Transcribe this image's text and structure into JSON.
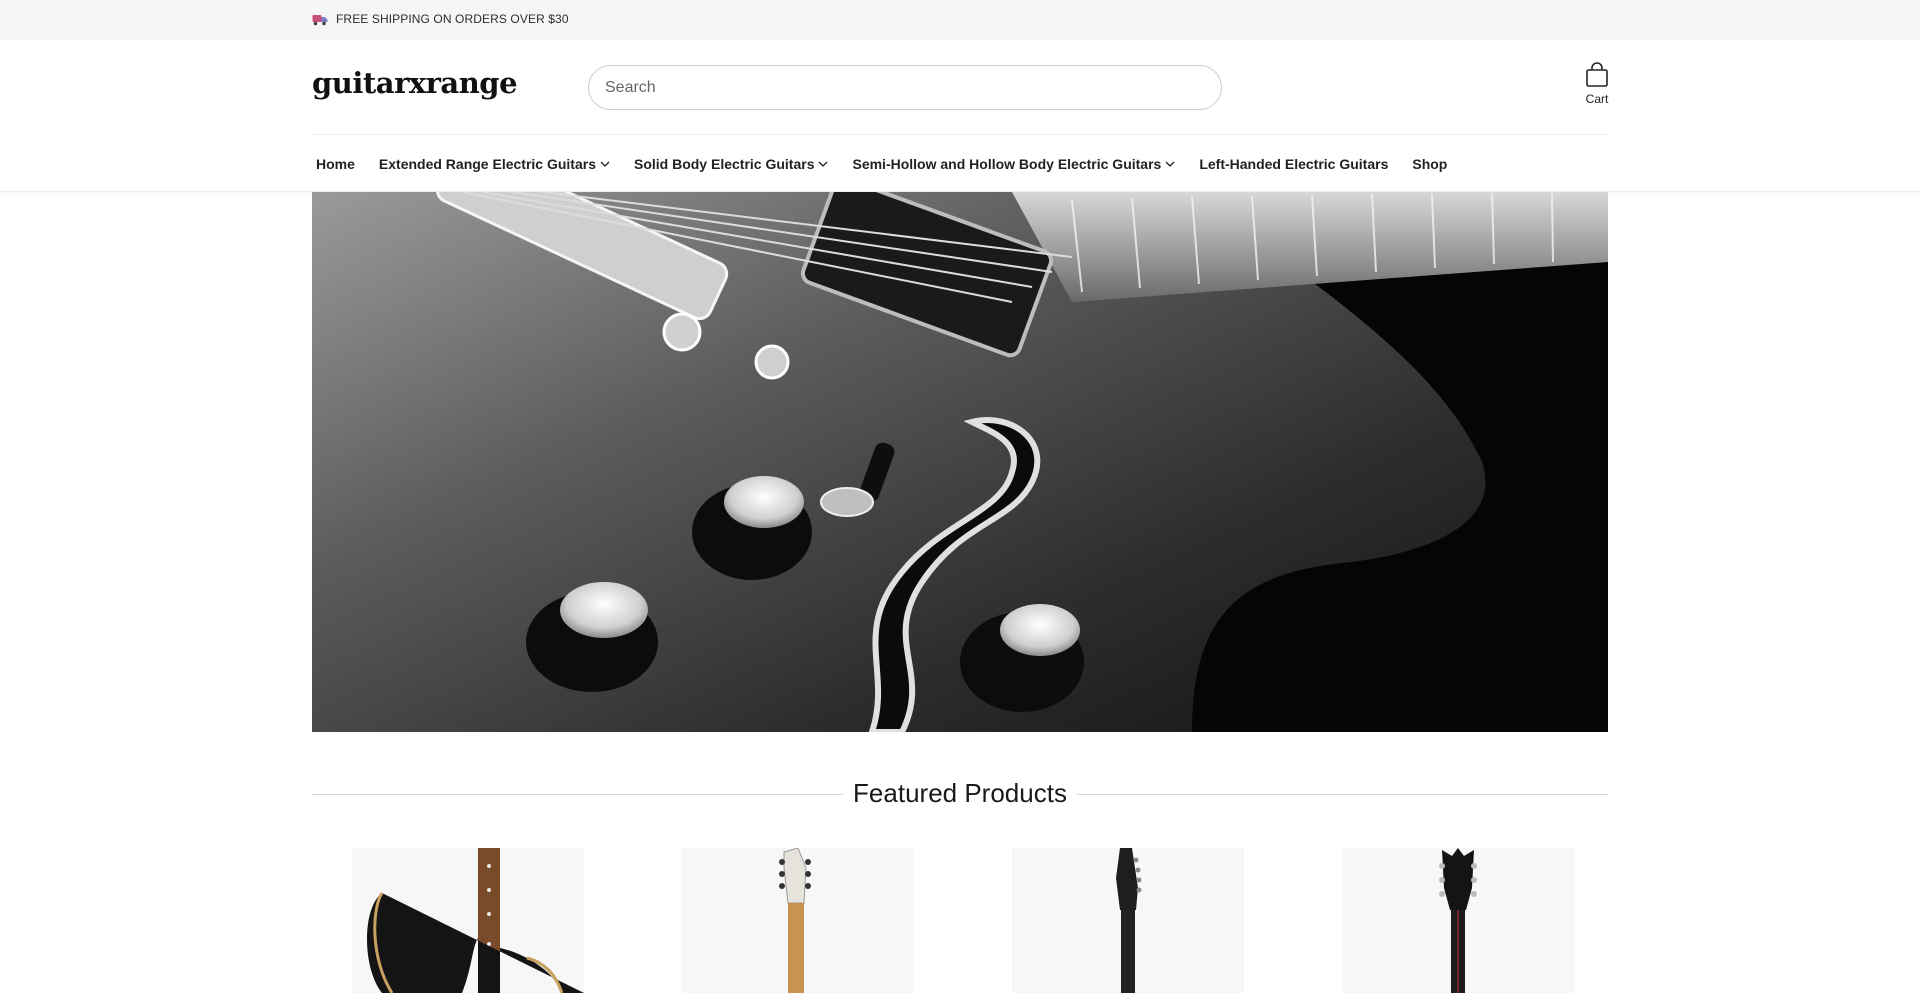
{
  "announcement": {
    "icon": "truck-icon",
    "text": "FREE SHIPPING ON ORDERS OVER $30"
  },
  "header": {
    "logo_text": "guitarxrange",
    "search": {
      "placeholder": "Search",
      "value": ""
    },
    "cart": {
      "icon": "bag-icon",
      "label": "Cart"
    }
  },
  "nav": {
    "items": [
      {
        "label": "Home",
        "has_dropdown": false
      },
      {
        "label": "Extended Range Electric Guitars",
        "has_dropdown": true
      },
      {
        "label": "Solid Body Electric Guitars",
        "has_dropdown": true
      },
      {
        "label": "Semi-Hollow and Hollow Body Electric Guitars",
        "has_dropdown": true
      },
      {
        "label": "Left-Handed Electric Guitars",
        "has_dropdown": false
      },
      {
        "label": "Shop",
        "has_dropdown": false
      }
    ]
  },
  "hero": {
    "image": "black-and-white-hollow-body-guitar-closeup"
  },
  "featured": {
    "title": "Featured Products",
    "products": [
      {
        "image": "black-guitar-body-rosewood-neck"
      },
      {
        "image": "white-headstock-7-string-guitar"
      },
      {
        "image": "black-7-string-guitar-headstock"
      },
      {
        "image": "black-ornate-headstock-guitar"
      }
    ]
  },
  "colors": {
    "announcement_bg": "#f5f6f8",
    "text": "#1a1a1a",
    "divider": "#d9d9d9"
  }
}
